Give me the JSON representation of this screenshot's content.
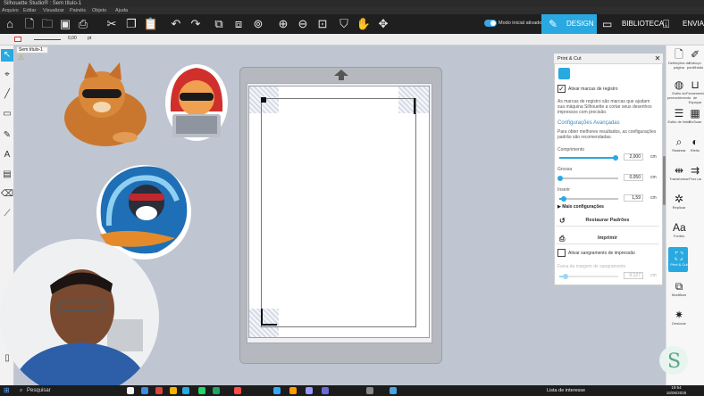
{
  "window": {
    "title": "Silhouette Studio® : Sem título-1"
  },
  "menu": [
    "Arquivo",
    "Editar",
    "Visualizar",
    "Painéis",
    "Objeto",
    "Ajuda"
  ],
  "toggle": {
    "label": "Modo inicial ativado",
    "on": true
  },
  "nav_tabs": [
    {
      "label": "DESIGN",
      "active": true,
      "icon": "design-icon"
    },
    {
      "label": "BIBLIOTECA",
      "active": false,
      "icon": "library-icon"
    },
    {
      "label": "ENVIAR",
      "active": false,
      "icon": "send-icon"
    }
  ],
  "options_bar": {
    "stroke_value": "0,00",
    "unit_label": "pt"
  },
  "document_tab": {
    "label": "Sem título-1"
  },
  "panel": {
    "title": "Print & Cut",
    "reg_marks_label": "Ativar marcas de registro",
    "reg_marks_checked": true,
    "reg_marks_desc": "As marcas de registro são marcas que ajudam sua máquina Silhouette a cortar seus desenhos impressos com precisão.",
    "advanced_title": "Configurações Avançadas",
    "advanced_desc": "Para obter melhores resultados, as configurações padrão são recomendadas.",
    "length_label": "Comprimento",
    "length_value": "2,000",
    "length_fraction": 0.95,
    "thickness_label": "Grossa",
    "thickness_value": "0,050",
    "thickness_fraction": 0.02,
    "inset_label": "Inserir",
    "inset_value": "1,59",
    "inset_fraction": 0.08,
    "unit": "cm",
    "more_settings_label": "Mais configurações",
    "restore_label": "Restaurar Padrões",
    "print_label": "Imprimir",
    "bleed_label": "Ativar sangramento de impressão",
    "bleed_checked": false,
    "bleed_margin_label": "Faixa da margem de sangramento",
    "bleed_margin_value": "0,127",
    "bleed_margin_fraction": 0.1
  },
  "right_column": [
    {
      "label": "Definições da página",
      "icon": "page-settings-icon"
    },
    {
      "label": "Estilo do preenchimento",
      "icon": "fill-style-icon"
    },
    {
      "label": "Estilo de linha",
      "icon": "line-style-icon"
    },
    {
      "label": "Rastrear",
      "icon": "trace-icon"
    },
    {
      "label": "Transformar",
      "icon": "transform-icon"
    },
    {
      "label": "Replicar",
      "icon": "replicate-icon"
    },
    {
      "label": "Fontes",
      "icon": "fonts-icon"
    },
    {
      "label": "Print & Cut",
      "icon": "print-cut-icon",
      "active": true
    },
    {
      "label": "Modificar",
      "icon": "modify-icon"
    },
    {
      "label": "Deslocar",
      "icon": "offset-icon"
    }
  ],
  "right_column2": [
    {
      "label": "Esboço pontilhado",
      "icon": "sketch-icon"
    },
    {
      "label": "Ferramenta de Espaçar",
      "icon": "spacing-icon"
    },
    {
      "label": "PixScan",
      "icon": "pixscan-icon"
    },
    {
      "label": "Efeito",
      "icon": "effect-icon"
    },
    {
      "label": "Prox ua",
      "icon": "next-icon"
    }
  ],
  "taskbar": {
    "search_placeholder": "Pesquisar",
    "news": "Lista de interesse",
    "time": "19:54",
    "date": "16/06/2025"
  },
  "colors": {
    "accent": "#29a9e1",
    "toolbar": "#1f1f1f",
    "canvas": "#bfc6d1"
  }
}
